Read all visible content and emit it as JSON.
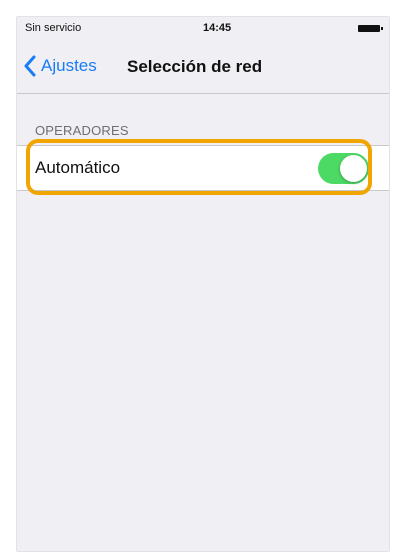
{
  "status_bar": {
    "carrier": "Sin servicio",
    "time": "14:45",
    "battery_icon": "battery-full-icon"
  },
  "nav": {
    "back_label": "Ajustes",
    "back_icon": "chevron-left-icon",
    "title": "Selección de red"
  },
  "section": {
    "header": "OPERADORES",
    "items": [
      {
        "label": "Automático",
        "toggle_on": true
      }
    ]
  },
  "colors": {
    "accent": "#1a7cf5",
    "toggle_on": "#4cd964",
    "highlight": "#f0a500",
    "background": "#efeff4"
  }
}
